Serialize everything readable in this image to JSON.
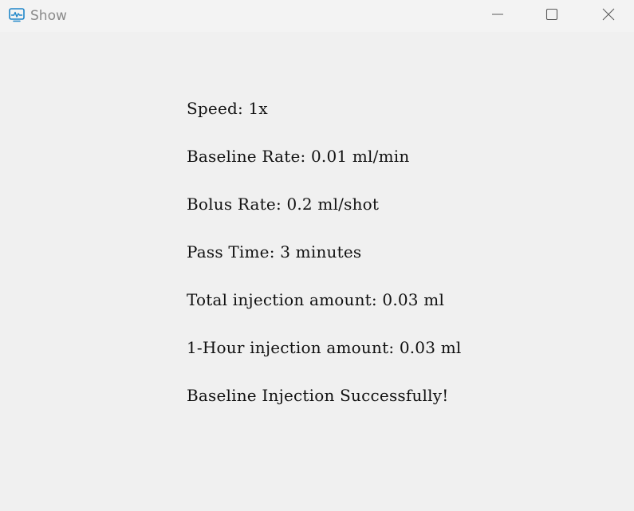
{
  "window": {
    "title": "Show",
    "app_icon": "monitor-chart-icon",
    "controls": {
      "minimize_icon": "minimize-icon",
      "maximize_icon": "maximize-icon",
      "close_icon": "close-icon"
    }
  },
  "info": {
    "speed": "Speed: 1x",
    "baseline_rate": "Baseline Rate: 0.01 ml/min",
    "bolus_rate": "Bolus Rate: 0.2 ml/shot",
    "pass_time": "Pass Time: 3 minutes",
    "total_injection": "Total injection amount: 0.03 ml",
    "hour_injection": "1-Hour injection amount: 0.03 ml",
    "status": "Baseline Injection Successfully!"
  },
  "colors": {
    "background": "#f0f0f0",
    "titlebar": "#f3f3f3",
    "title_text": "#8a8a8a",
    "icon_accent": "#1f86c9",
    "body_text": "#111111"
  }
}
